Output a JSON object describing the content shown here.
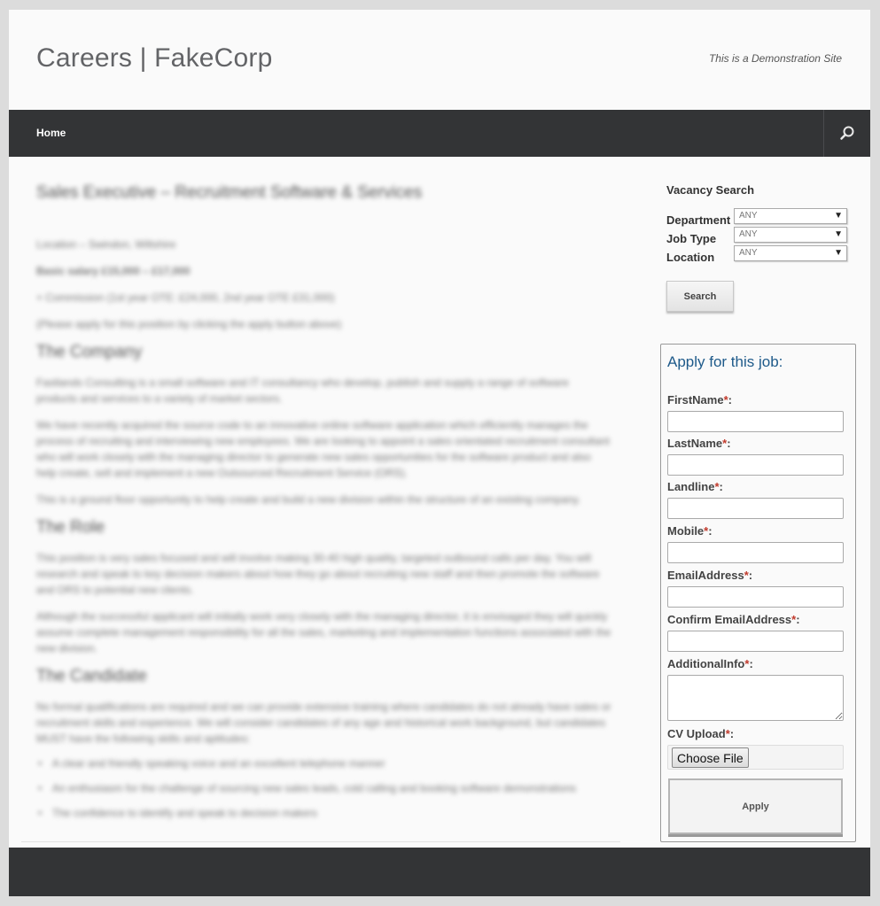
{
  "header": {
    "site_title": "Careers | FakeCorp",
    "tagline": "This is a Demonstration Site"
  },
  "nav": {
    "home_label": "Home"
  },
  "article": {
    "title": "Sales Executive – Recruitment Software & Services",
    "intro": [
      "Location – Swindon, Wiltshire",
      "Basic salary £15,000 – £17,000",
      "+ Commission (1st year OTE: £24,000, 2nd year OTE £31,000)",
      "(Please apply for this position by clicking the apply button above)"
    ],
    "company_heading": "The Company",
    "company_paras": [
      "Fastlands Consulting is a small software and IT consultancy who develop, publish and supply a range of software products and services to a variety of market sectors.",
      "We have recently acquired the source code to an innovative online software application which efficiently manages the process of recruiting and interviewing new employees. We are looking to appoint a sales orientated recruitment consultant who will work closely with the managing director to generate new sales opportunities for the software product and also help create, sell and implement a new Outsourced Recruitment Service (ORS).",
      "This is a ground floor opportunity to help create and build a new division within the structure of an existing company."
    ],
    "role_heading": "The Role",
    "role_paras": [
      "This position is very sales focused and will involve making 30-40 high quality, targeted outbound calls per day. You will research and speak to key decision makers about how they go about recruiting new staff and then promote the software and ORS to potential new clients.",
      "Although the successful applicant will initially work very closely with the managing director, it is envisaged they will quickly assume complete management responsibility for all the sales, marketing and implementation functions associated with the new division."
    ],
    "candidate_heading": "The Candidate",
    "candidate_paras": [
      "No formal qualifications are required and we can provide extensive training where candidates do not already have sales or recruitment skills and experience. We will consider candidates of any age and historical work background, but candidates MUST have the following skills and aptitudes:"
    ],
    "candidate_list": [
      "A clear and friendly speaking voice and an excellent telephone manner",
      "An enthusiasm for the challenge of sourcing new sales leads, cold calling and booking software demonstrations",
      "The confidence to identify and speak to decision makers"
    ]
  },
  "vacancy_search": {
    "title": "Vacancy Search",
    "department_label": "Department",
    "job_type_label": "Job Type",
    "location_label": "Location",
    "department_value": "ANY",
    "job_type_value": "ANY",
    "location_value": "ANY",
    "search_label": "Search"
  },
  "apply_form": {
    "title": "Apply for this job:",
    "required_marker": "*",
    "first_name_label": "FirstName",
    "last_name_label": "LastName",
    "landline_label": "Landline",
    "mobile_label": "Mobile",
    "email_label": "EmailAddress",
    "confirm_email_label": "Confirm EmailAddress",
    "additional_info_label": "AdditionalInfo",
    "cv_upload_label": "CV Upload",
    "choose_file_label": "Choose File",
    "apply_label": "Apply"
  }
}
